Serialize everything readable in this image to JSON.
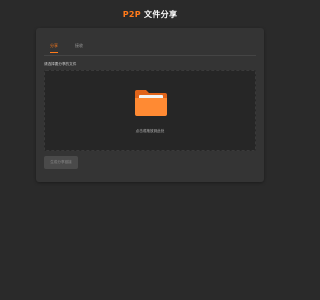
{
  "header": {
    "title_prefix": "P2P",
    "title_suffix": " 文件分享"
  },
  "tabs": [
    {
      "label": "分享",
      "active": true
    },
    {
      "label": "接收",
      "active": false
    }
  ],
  "send_panel": {
    "hint": "请选择要分享的文件",
    "dropzone_text": "点击或拖放到此处",
    "send_button_label": "生成分享链接",
    "send_button_enabled": false
  },
  "colors": {
    "accent": "#ff7a1a",
    "background": "#2a2a2a",
    "card": "#343434",
    "dropzone": "#262626"
  },
  "icons": {
    "dropzone": "folder-icon"
  }
}
